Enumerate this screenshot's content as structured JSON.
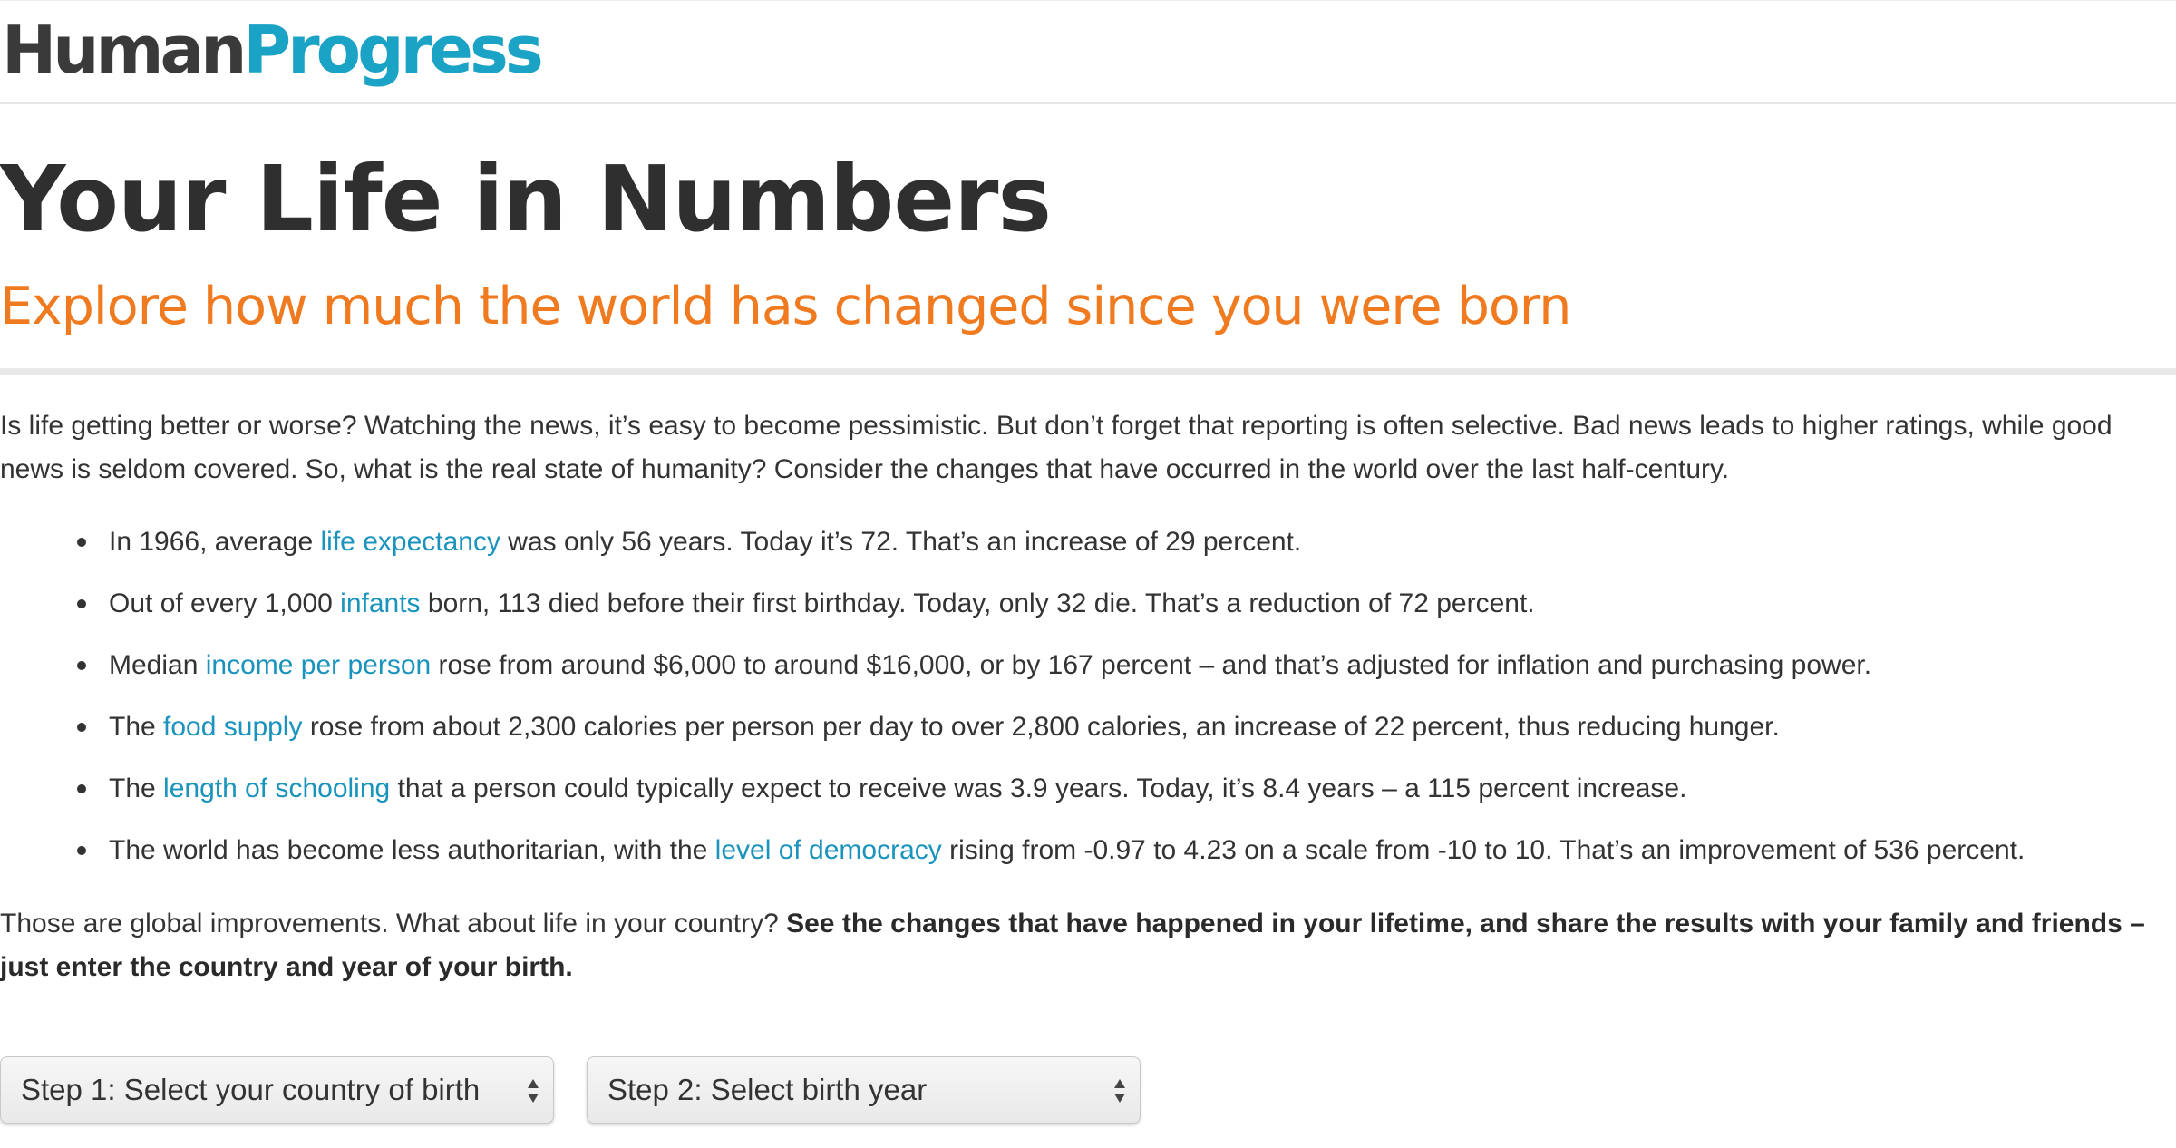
{
  "header": {
    "logo_part1": "Human",
    "logo_part2": "Progress"
  },
  "main": {
    "title": "Your Life in Numbers",
    "subtitle": "Explore how much the world has changed since you were born",
    "intro": "Is life getting better or worse? Watching the news, it’s easy to become pessimistic. But don’t forget that reporting is often selective. Bad news leads to higher ratings, while good news is seldom covered. So, what is the real state of humanity? Consider the changes that have occurred in the world over the last half-century.",
    "facts": [
      {
        "before": "In 1966, average ",
        "link": "life expectancy",
        "after": " was only 56 years. Today it’s 72. That’s an increase of 29 percent."
      },
      {
        "before": "Out of every 1,000 ",
        "link": "infants",
        "after": " born, 113 died before their first birthday. Today, only 32 die. That’s a reduction of 72 percent."
      },
      {
        "before": "Median ",
        "link": "income per person",
        "after": " rose from around $6,000 to around $16,000, or by 167 percent – and that’s adjusted for inflation and purchasing power."
      },
      {
        "before": "The ",
        "link": "food supply",
        "after": " rose from about 2,300 calories per person per day to over 2,800 calories, an increase of 22 percent, thus reducing hunger."
      },
      {
        "before": "The ",
        "link": "length of schooling",
        "after": " that a person could typically expect to receive was 3.9 years. Today, it’s 8.4 years – a 115 percent increase."
      },
      {
        "before": "The world has become less authoritarian, with the ",
        "link": "level of democracy",
        "after": " rising from -0.97 to 4.23 on a scale from -10 to 10. That’s an improvement of 536 percent."
      }
    ],
    "outro_plain": "Those are global improvements. What about life in your country? ",
    "outro_bold": "See the changes that have happened in your lifetime, and share the results with your family and friends – just enter the country and year of your birth."
  },
  "controls": {
    "country_select": "Step 1: Select your country of birth",
    "year_select": "Step 2: Select birth year",
    "icons": {
      "select_arrows": "up-down-arrows-icon"
    }
  },
  "colors": {
    "brand_dark": "#3a3a3a",
    "brand_blue": "#1ba3c6",
    "subtitle_orange": "#f07a1f",
    "link_blue": "#1a93bd",
    "text": "#333333"
  }
}
